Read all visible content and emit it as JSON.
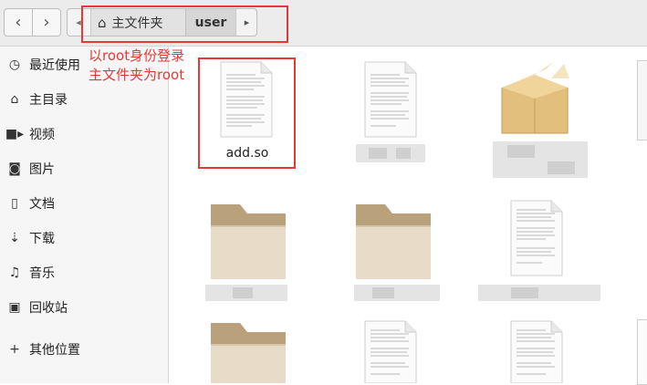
{
  "toolbar": {
    "back_icon": "chevron-left-icon",
    "forward_icon": "chevron-right-icon",
    "path": [
      {
        "label": "主文件夹",
        "icon": "home-icon"
      },
      {
        "label": "user"
      }
    ]
  },
  "annotation": {
    "line1": "以root身份登录",
    "line2": "主文件夹为root"
  },
  "sidebar": {
    "items": [
      {
        "label": "最近使用",
        "icon": "clock-icon"
      },
      {
        "label": "主目录",
        "icon": "home-icon"
      },
      {
        "label": "视频",
        "icon": "video-icon"
      },
      {
        "label": "图片",
        "icon": "camera-icon"
      },
      {
        "label": "文档",
        "icon": "document-icon"
      },
      {
        "label": "下载",
        "icon": "download-icon"
      },
      {
        "label": "音乐",
        "icon": "music-icon"
      },
      {
        "label": "回收站",
        "icon": "trash-icon"
      },
      {
        "label": "其他位置",
        "icon": "plus-icon"
      }
    ]
  },
  "files": [
    {
      "name": "add.so",
      "type": "text-file"
    },
    {
      "name": "",
      "type": "text-file"
    },
    {
      "name": "",
      "type": "package"
    },
    {
      "name": "",
      "type": "folder"
    },
    {
      "name": "",
      "type": "folder"
    },
    {
      "name": "",
      "type": "text-file"
    },
    {
      "name": "",
      "type": "folder"
    },
    {
      "name": "",
      "type": "text-file"
    },
    {
      "name": "",
      "type": "text-file"
    }
  ],
  "colors": {
    "annotation": "#e53935",
    "folder": "#cdb99a",
    "package": "#e2bf7c"
  }
}
